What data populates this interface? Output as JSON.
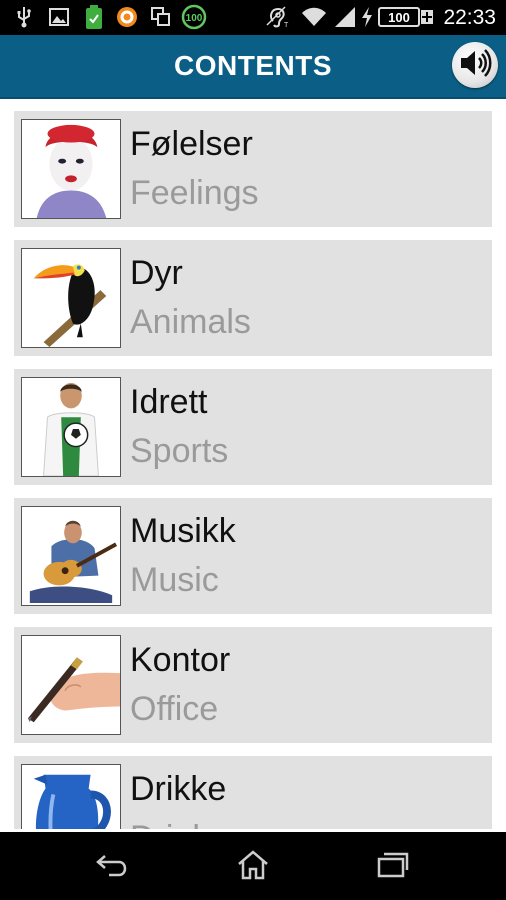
{
  "status_bar": {
    "time": "22:33",
    "battery_text": "100",
    "notification_badge": "100",
    "icons": [
      "usb-icon",
      "image-icon",
      "battery-saver-icon",
      "orange-app-icon",
      "screenshot-icon",
      "badge-100-icon",
      "hearing-aid-icon",
      "wifi-icon",
      "signal-icon",
      "charging-icon",
      "battery-icon"
    ]
  },
  "header": {
    "title": "CONTENTS",
    "sound_icon": "speaker-icon"
  },
  "colors": {
    "header_bg": "#0b5f86",
    "item_bg": "#e1e1e1",
    "secondary_text": "#9a9a9a"
  },
  "categories": [
    {
      "label": "Følelser",
      "translation": "Feelings",
      "thumbnail": "mime-face"
    },
    {
      "label": "Dyr",
      "translation": "Animals",
      "thumbnail": "toucan"
    },
    {
      "label": "Idrett",
      "translation": "Sports",
      "thumbnail": "soccer-player"
    },
    {
      "label": "Musikk",
      "translation": "Music",
      "thumbnail": "guitarist"
    },
    {
      "label": "Kontor",
      "translation": "Office",
      "thumbnail": "hand-with-pen"
    },
    {
      "label": "Drikke",
      "translation": "Drinks",
      "thumbnail": "blue-pitcher"
    }
  ],
  "nav_bar": {
    "icons": [
      "back-icon",
      "home-icon",
      "recent-apps-icon"
    ]
  }
}
